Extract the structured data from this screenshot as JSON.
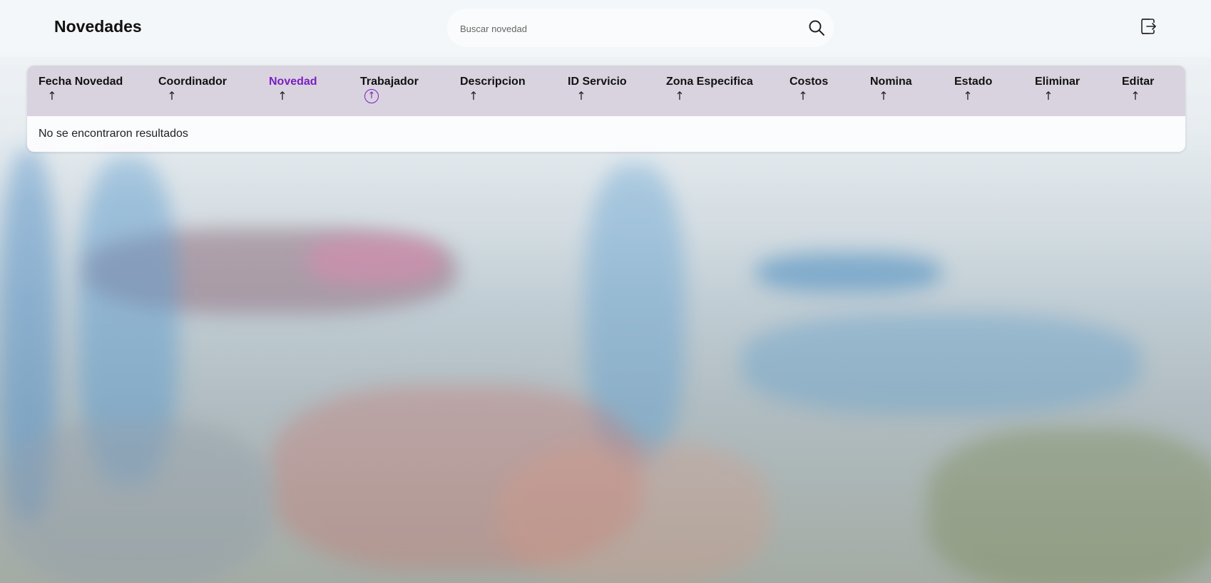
{
  "header": {
    "title": "Novedades",
    "search_placeholder": "Buscar novedad",
    "search_value": ""
  },
  "table": {
    "columns": [
      {
        "label": "Fecha Novedad",
        "sort": "↑"
      },
      {
        "label": "Coordinador",
        "sort": "↑"
      },
      {
        "label": "Novedad",
        "sort": "↑",
        "active": true
      },
      {
        "label": "Trabajador",
        "sort": "↑",
        "focused": true
      },
      {
        "label": "Descripcion",
        "sort": "↑"
      },
      {
        "label": "ID Servicio",
        "sort": "↑"
      },
      {
        "label": "Zona Especifica",
        "sort": "↑"
      },
      {
        "label": "Costos",
        "sort": "↑"
      },
      {
        "label": "Nomina",
        "sort": "↑"
      },
      {
        "label": "Estado",
        "sort": "↑"
      },
      {
        "label": "Eliminar",
        "sort": "↑"
      },
      {
        "label": "Editar",
        "sort": "↑"
      }
    ],
    "empty_message": "No se encontraron resultados"
  },
  "colors": {
    "accent": "#7a1fbf",
    "header_bg": "#d9d3e0"
  },
  "icons": {
    "search": "search-icon",
    "logout": "logout-icon"
  }
}
